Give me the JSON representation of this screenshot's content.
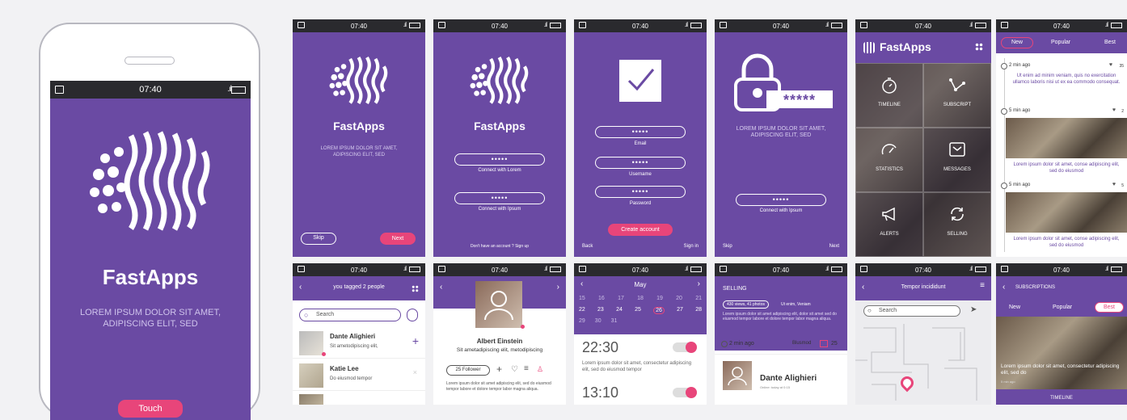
{
  "status_time": "07:40",
  "app_name": "FastApps",
  "tagline": "LOREM IPSUM DOLOR SIT AMET, ADIPISCING ELIT, SED",
  "big_phone": {
    "button": "Touch"
  },
  "intro": {
    "skip": "Skip",
    "next": "Next"
  },
  "login": {
    "dots": "•••••",
    "connect_lorem": "Connect with Lorem",
    "connect_ipsum": "Connect with Ipsum",
    "footer": "Don't have an account ?   Sign up"
  },
  "signup": {
    "email": "Email",
    "username": "Username",
    "password": "Password",
    "create": "Create account",
    "back": "Back",
    "signin": "Sign in"
  },
  "lock": {
    "stars": "*****",
    "connect": "Connect with Ipsum",
    "skip": "Skip",
    "next": "Next"
  },
  "menu": {
    "items": [
      "TIMELINE",
      "SUBSCRIPT",
      "STATISTICS",
      "MESSAGES",
      "ALERTS",
      "SELLING"
    ]
  },
  "feed": {
    "tabs": [
      "New",
      "Popular",
      "Best"
    ],
    "items": [
      {
        "time": "2 min ago",
        "likes": "35",
        "text": "Ut enim ad minim veniam, quis no exercitation ullamco laboris nisi ut ex ea commodo consequat."
      },
      {
        "time": "5 min ago",
        "likes": "2",
        "text": "Lorem ipsum dolor sit amet, conse adipiscing elit, sed do eiusmod"
      },
      {
        "time": "5 min ago",
        "likes": "5",
        "text": "Lorem ipsum dolor sit amet, conse adipiscing elit, sed do eiusmod"
      }
    ]
  },
  "tagged": {
    "header": "you tagged   2  people",
    "search": "Search",
    "people": [
      {
        "name": "Dante Alighieri",
        "sub": "Sit ametodipiscing elit,"
      },
      {
        "name": "Katie Lee",
        "sub": "Do eiusmod tempor"
      }
    ]
  },
  "profile": {
    "name": "Albert Einstein",
    "sub": "Sit ametadipiscing elit, metodipiscing",
    "followers": "25  Follower",
    "text": "Lorem ipsum dolor sit amet adipiscing elit, sed do eiusmod tempor labore et dolore tempor labor magna aliqua."
  },
  "calendar": {
    "month": "May",
    "row1": [
      "15",
      "16",
      "17",
      "18",
      "19",
      "20",
      "21"
    ],
    "row2": [
      "22",
      "23",
      "24",
      "25",
      "26",
      "27",
      "28"
    ],
    "row3": [
      "29",
      "30",
      "31"
    ],
    "alarm1": "22:30",
    "alarm_text": "Lorem ipsum dolor sit amet, consectetur adipiscing elit, sed do eiusmod tempor",
    "alarm2": "13:10"
  },
  "selling": {
    "header": "SELLING",
    "views": "430 views, 41 photos",
    "loc": "Ut enim, Veniam",
    "text": "Lorem ipsum dolor sit amet adipiscing elit, dolor sit amet sed do eiusmod tempor labore et dolore tempor labor magna aliqua.",
    "time": "2 min ago",
    "user_short": "Blusmod",
    "count": "25",
    "person": "Dante Alighieri",
    "person_sub": "Online: today at 0:15"
  },
  "map": {
    "header": "Tempor incididunt",
    "search": "Search"
  },
  "subs": {
    "header": "SUBSCRIPTIONS",
    "tabs": [
      "New",
      "Popular",
      "Best"
    ],
    "text": "Lorem ipsum dolor sit amet, consectetur adipiscing elit, sed do",
    "time": "5 min ago",
    "footer": "TIMELINE"
  }
}
